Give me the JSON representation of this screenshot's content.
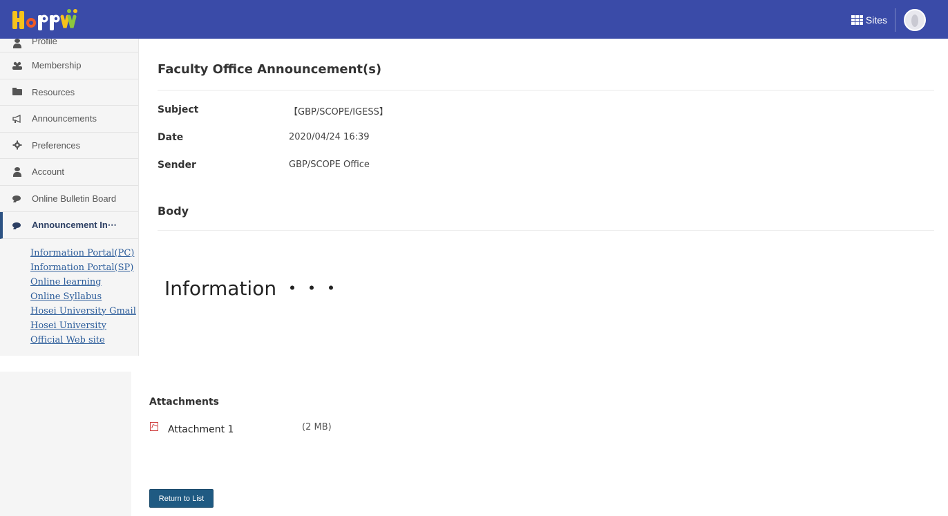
{
  "app": {
    "logo_alt": "Hoppii",
    "sites_label": "Sites"
  },
  "sidebar": {
    "items": [
      {
        "label": "Profile",
        "icon": "person-icon"
      },
      {
        "label": "Membership",
        "icon": "group-icon"
      },
      {
        "label": "Resources",
        "icon": "folder-icon"
      },
      {
        "label": "Announcements",
        "icon": "megaphone-icon"
      },
      {
        "label": "Preferences",
        "icon": "gear-icon"
      },
      {
        "label": "Account",
        "icon": "person-icon"
      },
      {
        "label": "Online Bulletin Board",
        "icon": "chat-icon"
      },
      {
        "label": "Announcement In⋯",
        "icon": "chat-icon",
        "active": true
      }
    ],
    "links": [
      "Information Portal(PC)",
      "Information Portal(SP)",
      "Online learning",
      "Online Syllabus",
      "Hosei University Gmail",
      "Hosei University",
      "Official Web site"
    ]
  },
  "main": {
    "title": "Faculty Office Announcement(s)",
    "fields": {
      "subject_label": "Subject",
      "subject_value": "【GBP/SCOPE/IGESS】",
      "date_label": "Date",
      "date_value": "2020/04/24 16:39",
      "sender_label": "Sender",
      "sender_value": "GBP/SCOPE Office"
    },
    "body_label": "Body",
    "body_text": "Information ・・・",
    "attachments_label": "Attachments",
    "attachment": {
      "name": "Attachment 1",
      "size": "(2 MB)"
    },
    "return_label": "Return to List"
  },
  "colors": {
    "topbar": "#3a4ba8",
    "button": "#1f5a82",
    "link": "#2b5c9a"
  }
}
